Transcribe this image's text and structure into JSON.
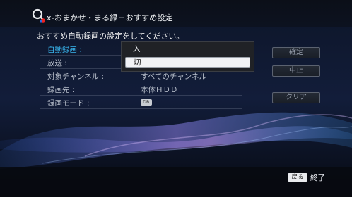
{
  "header": {
    "title": "x-おまかせ・まる録－おすすめ設定",
    "logo_icon": "magnifier-q-logo"
  },
  "instruction": "おすすめ自動録画の設定をしてください。",
  "settings": [
    {
      "label": "自動録画 :",
      "value": ""
    },
    {
      "label": "放送 :",
      "value": ""
    },
    {
      "label": "対象チャンネル :",
      "value": "すべてのチャンネル"
    },
    {
      "label": "録画先 :",
      "value": "本体ＨＤＤ"
    },
    {
      "label": "録画モード :",
      "value": "DR"
    }
  ],
  "dropdown": {
    "options": [
      "入",
      "切"
    ],
    "selected": "切"
  },
  "buttons": {
    "confirm": "確定",
    "cancel": "中止",
    "clear": "クリア"
  },
  "footer": {
    "back_key": "戻る",
    "back_label": "終了"
  },
  "colors": {
    "accent": "#39b7f0",
    "background": "#0a0f1c"
  }
}
